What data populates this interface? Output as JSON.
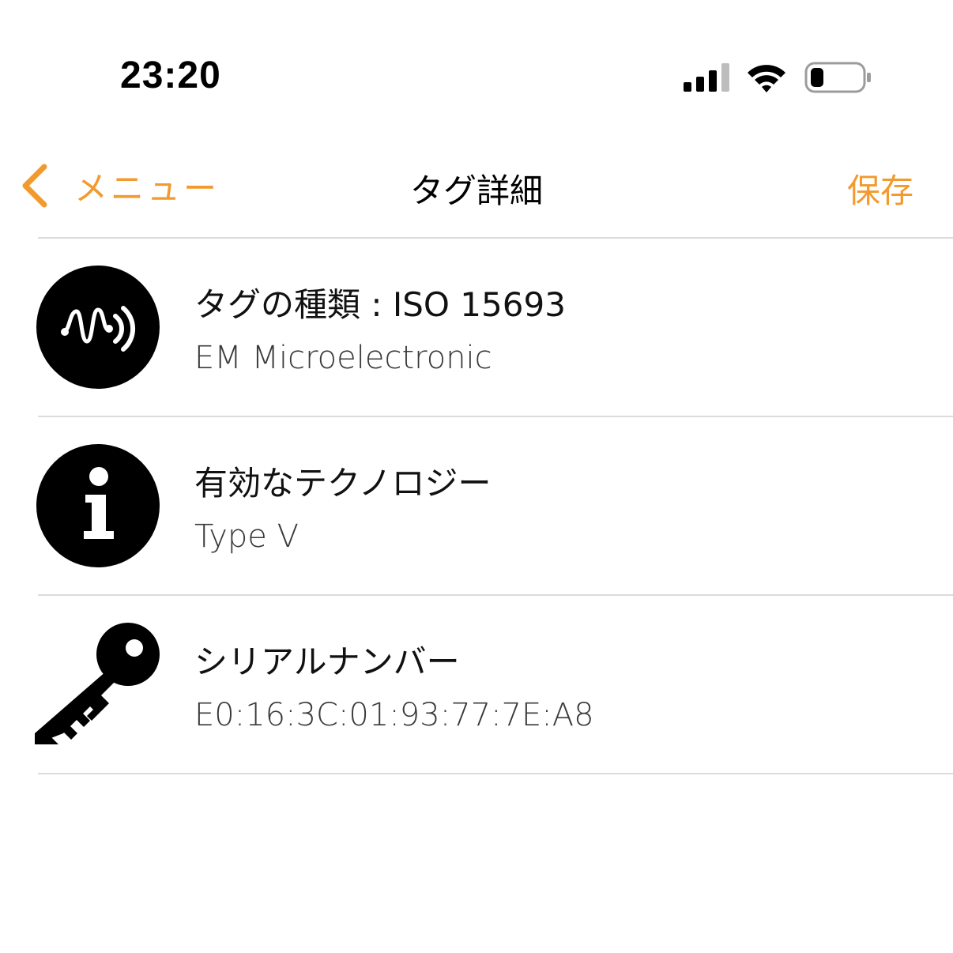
{
  "status_bar": {
    "time": "23:20",
    "icons": [
      "cellular-signal-icon",
      "wifi-icon",
      "battery-icon"
    ]
  },
  "nav": {
    "back_label": "メニュー",
    "title": "タグ詳細",
    "save_label": "保存",
    "accent_color": "#F29A2E"
  },
  "rows": [
    {
      "icon": "nfc-tag-icon",
      "title": "タグの種類 : ISO 15693",
      "subtitle": "EM Microelectronic"
    },
    {
      "icon": "info-icon",
      "title": "有効なテクノロジー",
      "subtitle": "Type V"
    },
    {
      "icon": "key-icon",
      "title": "シリアルナンバー",
      "subtitle": "E0:16:3C:01:93:77:7E:A8"
    }
  ]
}
